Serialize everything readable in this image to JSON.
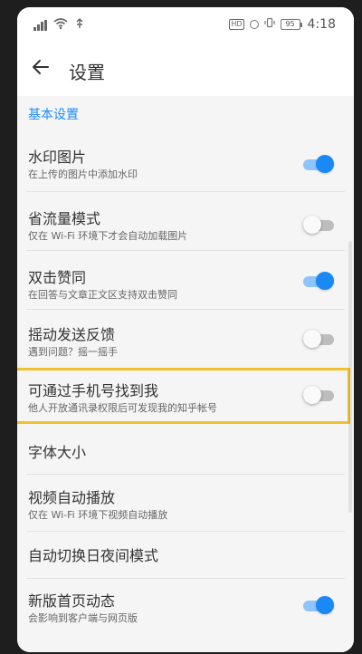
{
  "status_bar": {
    "left_icons": [
      "signal-icon",
      "wifi-icon",
      "usb-icon"
    ],
    "hd_label": "HD",
    "battery_level": "95",
    "time": "4:18"
  },
  "app_bar": {
    "back_icon": "arrow-left-icon",
    "title": "设置"
  },
  "section": {
    "header": "基本设置"
  },
  "settings": [
    {
      "title": "水印图片",
      "subtitle": "在上传的图片中添加水印",
      "toggle": "on"
    },
    {
      "title": "省流量模式",
      "subtitle": "仅在 Wi-Fi 环境下才会自动加载图片",
      "toggle": "off"
    },
    {
      "title": "双击赞同",
      "subtitle": "在回答与文章正文区支持双击赞同",
      "toggle": "on"
    },
    {
      "title": "摇动发送反馈",
      "subtitle": "遇到问题？摇一摇手",
      "toggle": "off"
    },
    {
      "title": "可通过手机号找到我",
      "subtitle": "他人开放通讯录权限后可发现我的知乎帐号",
      "toggle": "off"
    },
    {
      "title": "字体大小",
      "subtitle": "",
      "toggle": null
    },
    {
      "title": "视频自动播放",
      "subtitle": "仅在 Wi-Fi 环境下视频自动播放",
      "toggle": null
    },
    {
      "title": "自动切换日夜间模式",
      "subtitle": "",
      "toggle": null
    },
    {
      "title": "新版首页动态",
      "subtitle": "会影响到客户端与网页版",
      "toggle": "on"
    }
  ],
  "colors": {
    "accent": "#1a88f5",
    "highlight": "#f2c12e"
  }
}
